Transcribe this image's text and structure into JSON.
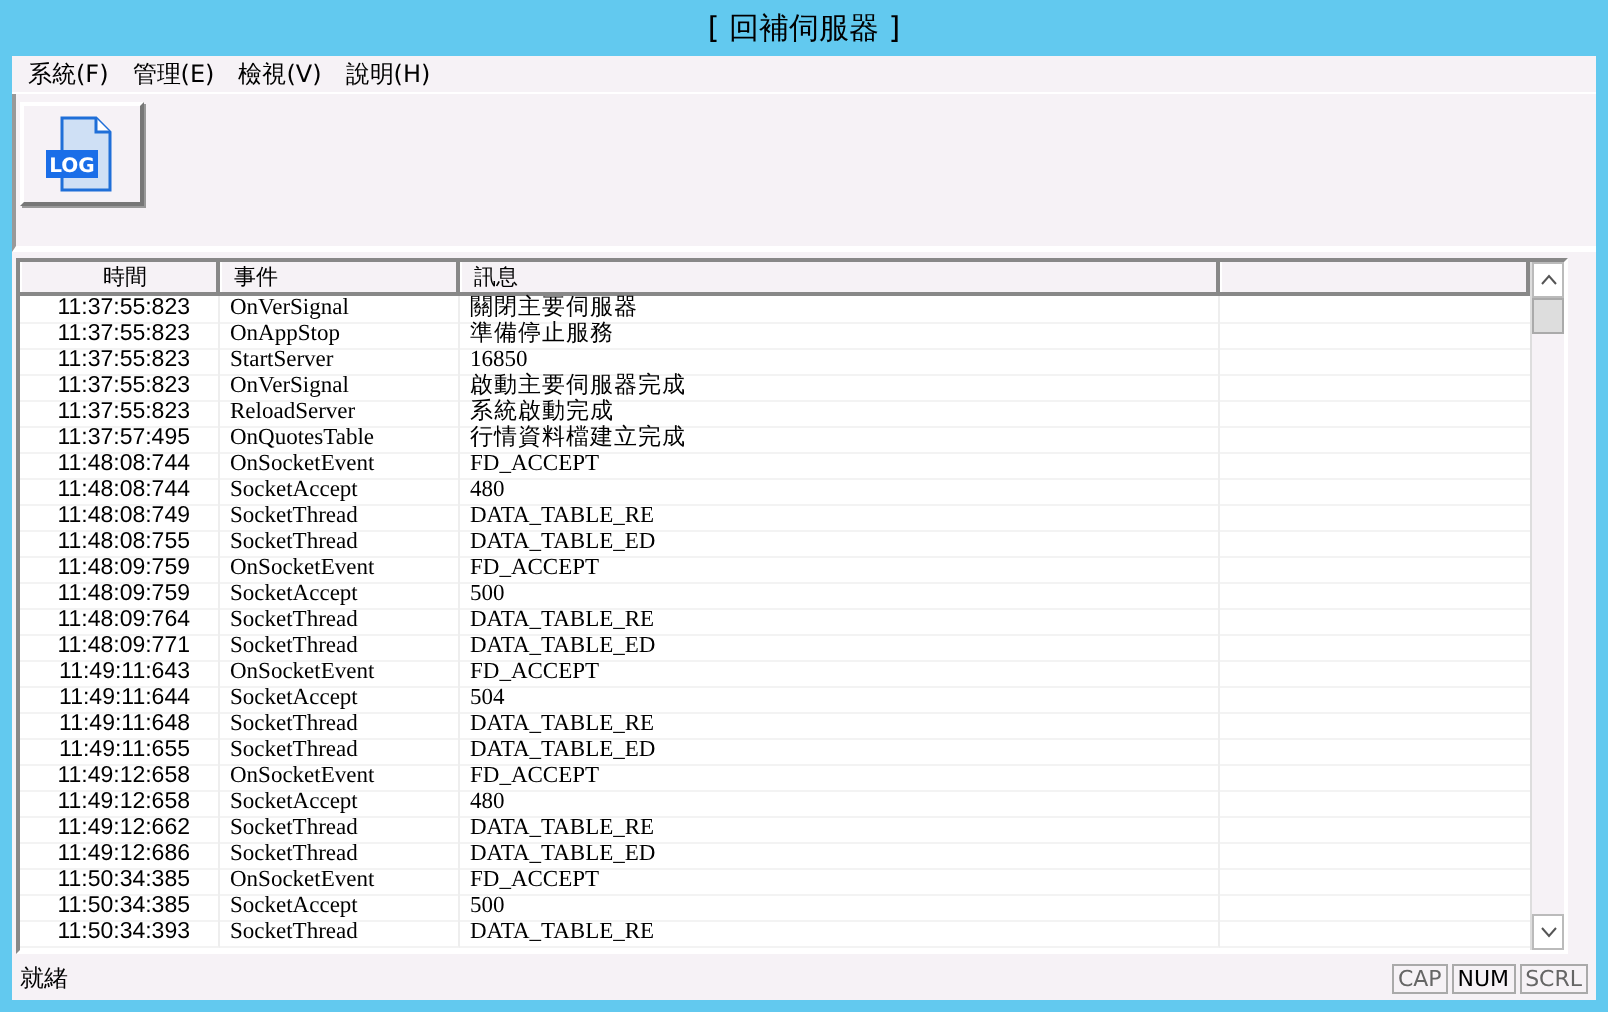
{
  "window": {
    "title": "[ 回補伺服器 ]"
  },
  "menu": [
    "系統(F)",
    "管理(E)",
    "檢視(V)",
    "說明(H)"
  ],
  "toolbar": [
    {
      "label": "LOG"
    }
  ],
  "table": {
    "columns": [
      "時間",
      "事件",
      "訊息"
    ],
    "rows": [
      [
        "11:37:55:823",
        "OnVerSignal",
        "關閉主要伺服器"
      ],
      [
        "11:37:55:823",
        "OnAppStop",
        "準備停止服務"
      ],
      [
        "11:37:55:823",
        "StartServer",
        "16850"
      ],
      [
        "11:37:55:823",
        "OnVerSignal",
        "啟動主要伺服器完成"
      ],
      [
        "11:37:55:823",
        "ReloadServer",
        "系統啟動完成"
      ],
      [
        "11:37:57:495",
        "OnQuotesTable",
        "行情資料檔建立完成"
      ],
      [
        "11:48:08:744",
        "OnSocketEvent",
        "FD_ACCEPT"
      ],
      [
        "11:48:08:744",
        "SocketAccept",
        "480"
      ],
      [
        "11:48:08:749",
        "SocketThread",
        "DATA_TABLE_RE"
      ],
      [
        "11:48:08:755",
        "SocketThread",
        "DATA_TABLE_ED"
      ],
      [
        "11:48:09:759",
        "OnSocketEvent",
        "FD_ACCEPT"
      ],
      [
        "11:48:09:759",
        "SocketAccept",
        "500"
      ],
      [
        "11:48:09:764",
        "SocketThread",
        "DATA_TABLE_RE"
      ],
      [
        "11:48:09:771",
        "SocketThread",
        "DATA_TABLE_ED"
      ],
      [
        "11:49:11:643",
        "OnSocketEvent",
        "FD_ACCEPT"
      ],
      [
        "11:49:11:644",
        "SocketAccept",
        "504"
      ],
      [
        "11:49:11:648",
        "SocketThread",
        "DATA_TABLE_RE"
      ],
      [
        "11:49:11:655",
        "SocketThread",
        "DATA_TABLE_ED"
      ],
      [
        "11:49:12:658",
        "OnSocketEvent",
        "FD_ACCEPT"
      ],
      [
        "11:49:12:658",
        "SocketAccept",
        "480"
      ],
      [
        "11:49:12:662",
        "SocketThread",
        "DATA_TABLE_RE"
      ],
      [
        "11:49:12:686",
        "SocketThread",
        "DATA_TABLE_ED"
      ],
      [
        "11:50:34:385",
        "OnSocketEvent",
        "FD_ACCEPT"
      ],
      [
        "11:50:34:385",
        "SocketAccept",
        "500"
      ],
      [
        "11:50:34:393",
        "SocketThread",
        "DATA_TABLE_RE"
      ]
    ]
  },
  "status_bar": {
    "text": "就緒",
    "indicators": [
      {
        "label": "CAP",
        "on": false
      },
      {
        "label": "NUM",
        "on": true
      },
      {
        "label": "SCRL",
        "on": false
      }
    ]
  }
}
